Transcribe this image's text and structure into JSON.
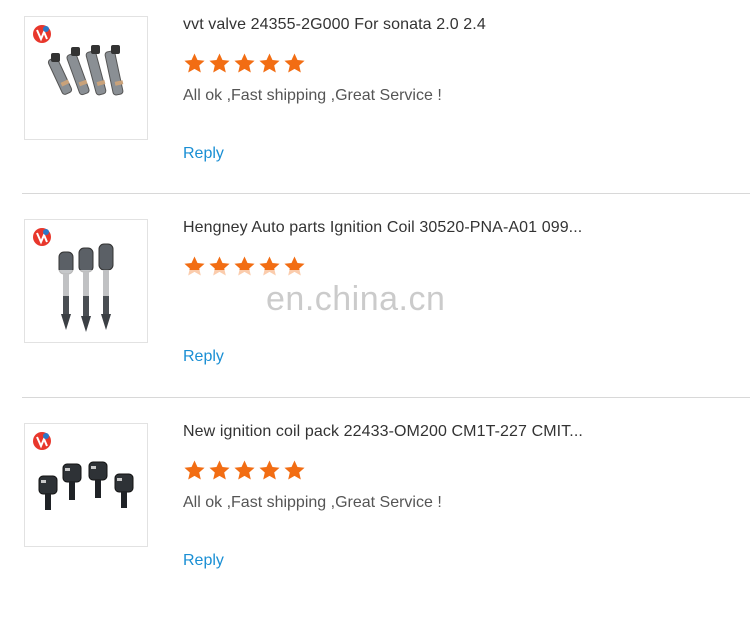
{
  "reviews": [
    {
      "product_title": "vvt valve 24355-2G000 For sonata 2.0 2.4",
      "rating": 5,
      "comment": "All ok ,Fast shipping ,Great Service !",
      "reply_label": "Reply",
      "thumbnail_icon": "vvt-valve-product-image"
    },
    {
      "product_title": "Hengney Auto parts Ignition Coil 30520-PNA-A01 099...",
      "rating": 5,
      "comment": "",
      "reply_label": "Reply",
      "thumbnail_icon": "ignition-coil-product-image"
    },
    {
      "product_title": "New ignition coil pack 22433-OM200 CM1T-227 CMIT...",
      "rating": 5,
      "comment": "All ok ,Fast shipping ,Great Service !",
      "reply_label": "Reply",
      "thumbnail_icon": "coil-pack-product-image"
    }
  ],
  "watermark": "en.china.cn",
  "colors": {
    "star": "#f26d13",
    "reply_link": "#1a8fd4",
    "divider": "#d8d8d8",
    "brand_badge": "#e8372c"
  }
}
